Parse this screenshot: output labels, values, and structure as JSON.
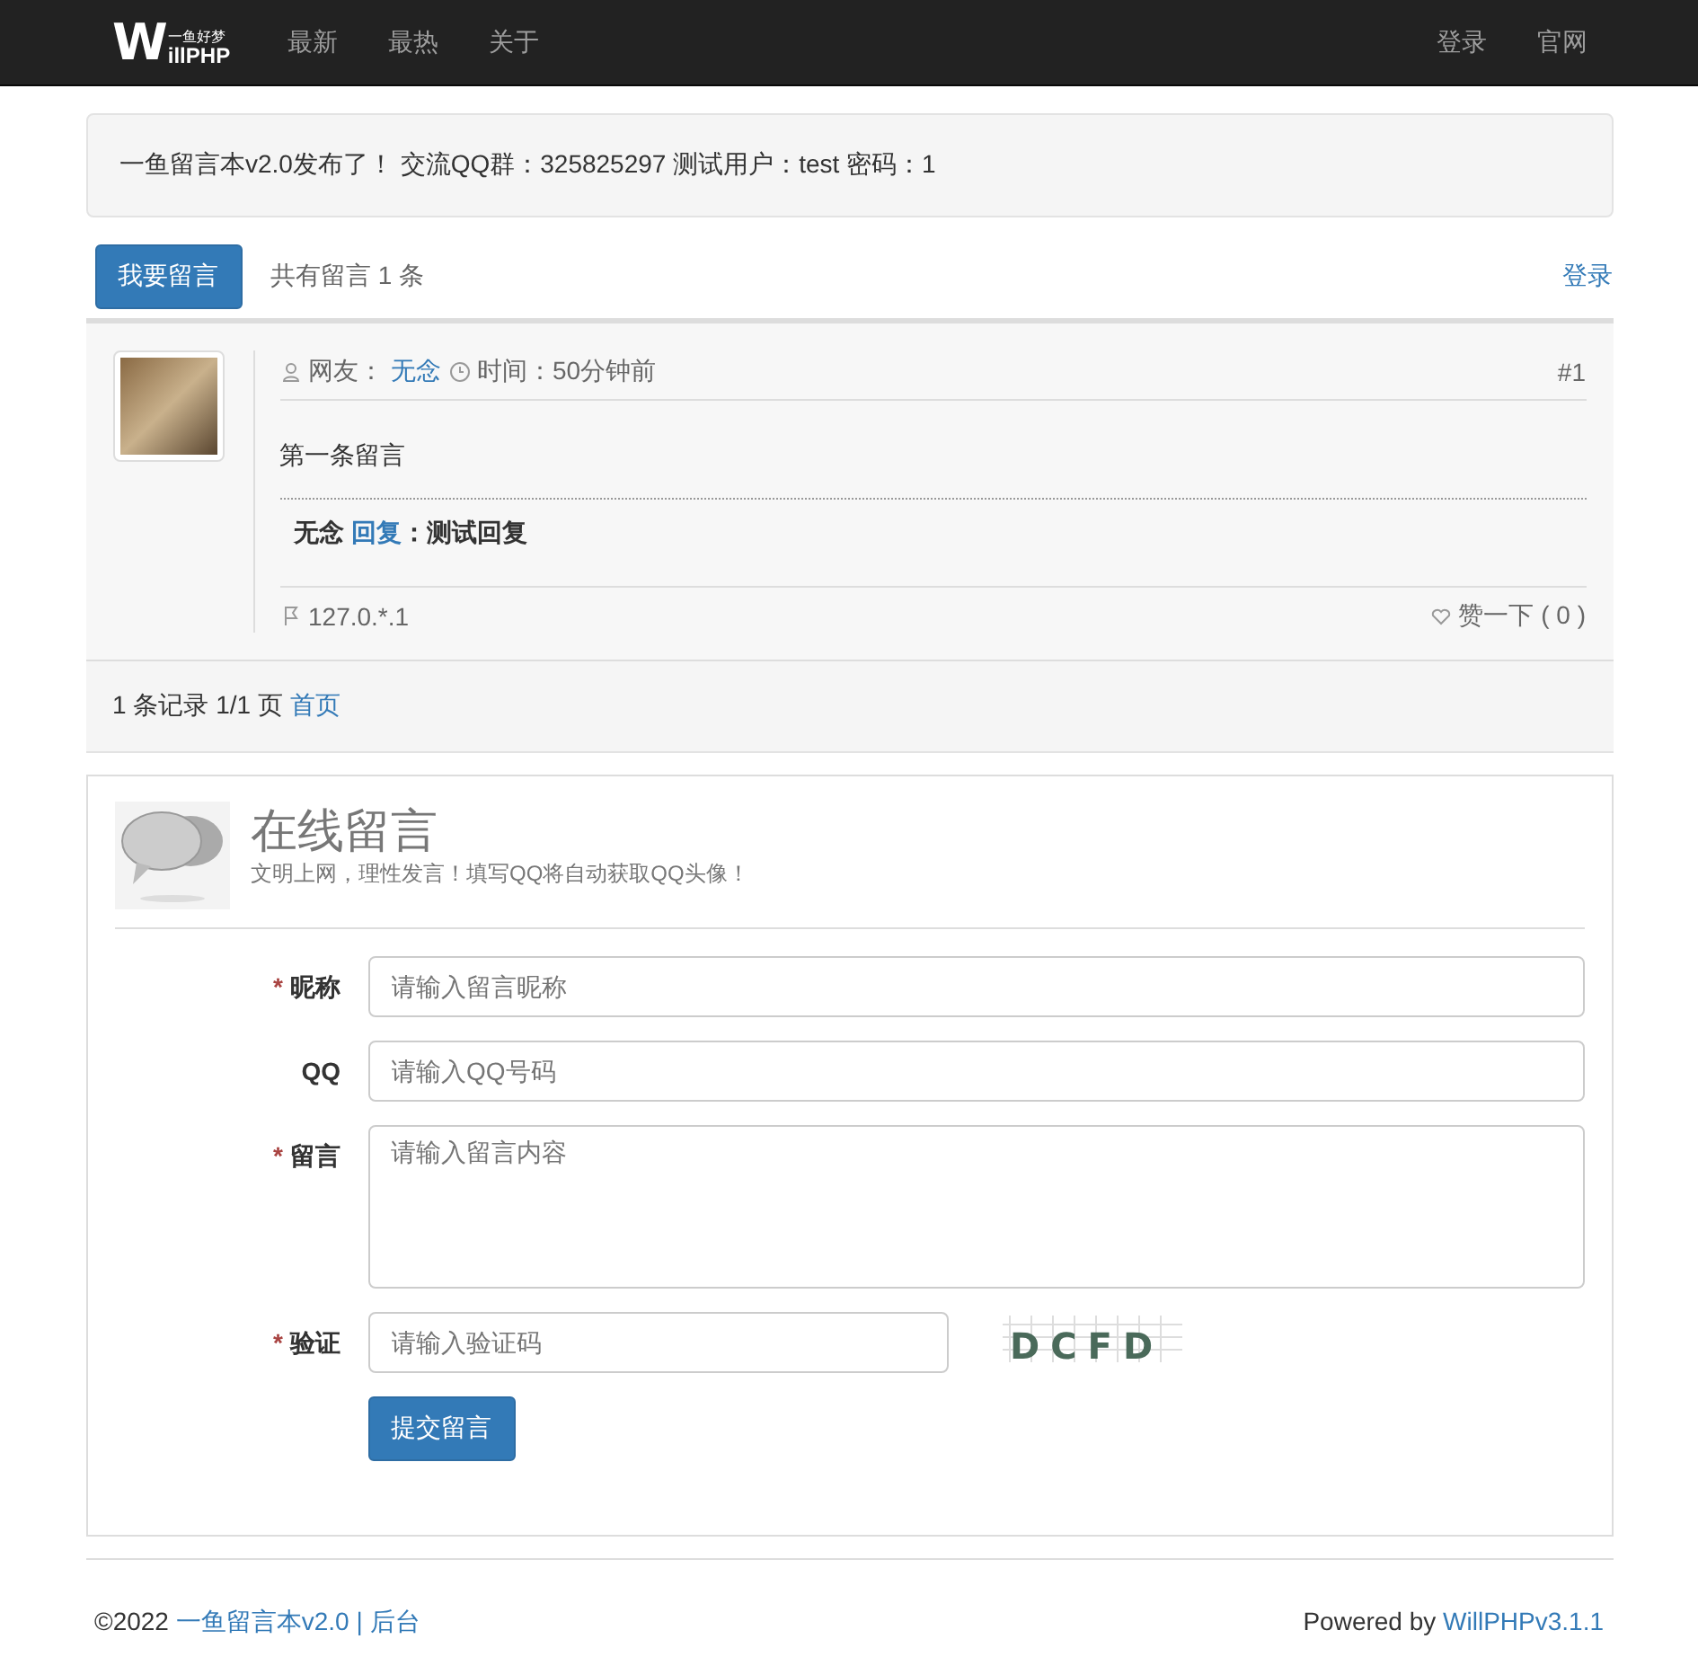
{
  "navbar": {
    "logo": {
      "big": "W",
      "small": "一鱼好梦",
      "rest": "illPHP"
    },
    "links": [
      {
        "label": "最新"
      },
      {
        "label": "最热"
      },
      {
        "label": "关于"
      }
    ],
    "right_links": [
      {
        "label": "登录"
      },
      {
        "label": "官网"
      }
    ]
  },
  "notice": "一鱼留言本v2.0发布了！ 交流QQ群：325825297 测试用户：test 密码：1",
  "toolbar": {
    "button": "我要留言",
    "count": "共有留言 1 条",
    "login": "登录"
  },
  "messages": [
    {
      "user_label": "网友：",
      "user": "无念",
      "time": "时间：50分钟前",
      "number": "#1",
      "content": "第一条留言",
      "reply": {
        "author": "无念",
        "link": "回复",
        "text": "：测试回复"
      },
      "ip": "127.0.*.1",
      "like": "赞一下 ( 0 )"
    }
  ],
  "pagination": {
    "summary": "1 条记录 1/1 页",
    "first": "首页"
  },
  "form": {
    "title": "在线留言",
    "subtitle": "文明上网，理性发言！填写QQ将自动获取QQ头像！",
    "fields": [
      {
        "kind": "input",
        "label": "昵称",
        "required_mark": "*",
        "placeholder": "请输入留言昵称"
      },
      {
        "kind": "input",
        "label": "QQ",
        "placeholder": "请输入QQ号码"
      },
      {
        "kind": "textarea",
        "label": "留言",
        "required_mark": "*",
        "placeholder": "请输入留言内容"
      },
      {
        "kind": "captcha",
        "label": "验证",
        "required_mark": "*",
        "placeholder": "请输入验证码",
        "captcha": "DCFD"
      }
    ],
    "submit": "提交留言"
  },
  "footer": {
    "copyright": "©2022",
    "site": "一鱼留言本v2.0",
    "separator": "|",
    "admin": "后台",
    "powered": "Powered by",
    "framework": "WillPHPv3.1.1"
  }
}
